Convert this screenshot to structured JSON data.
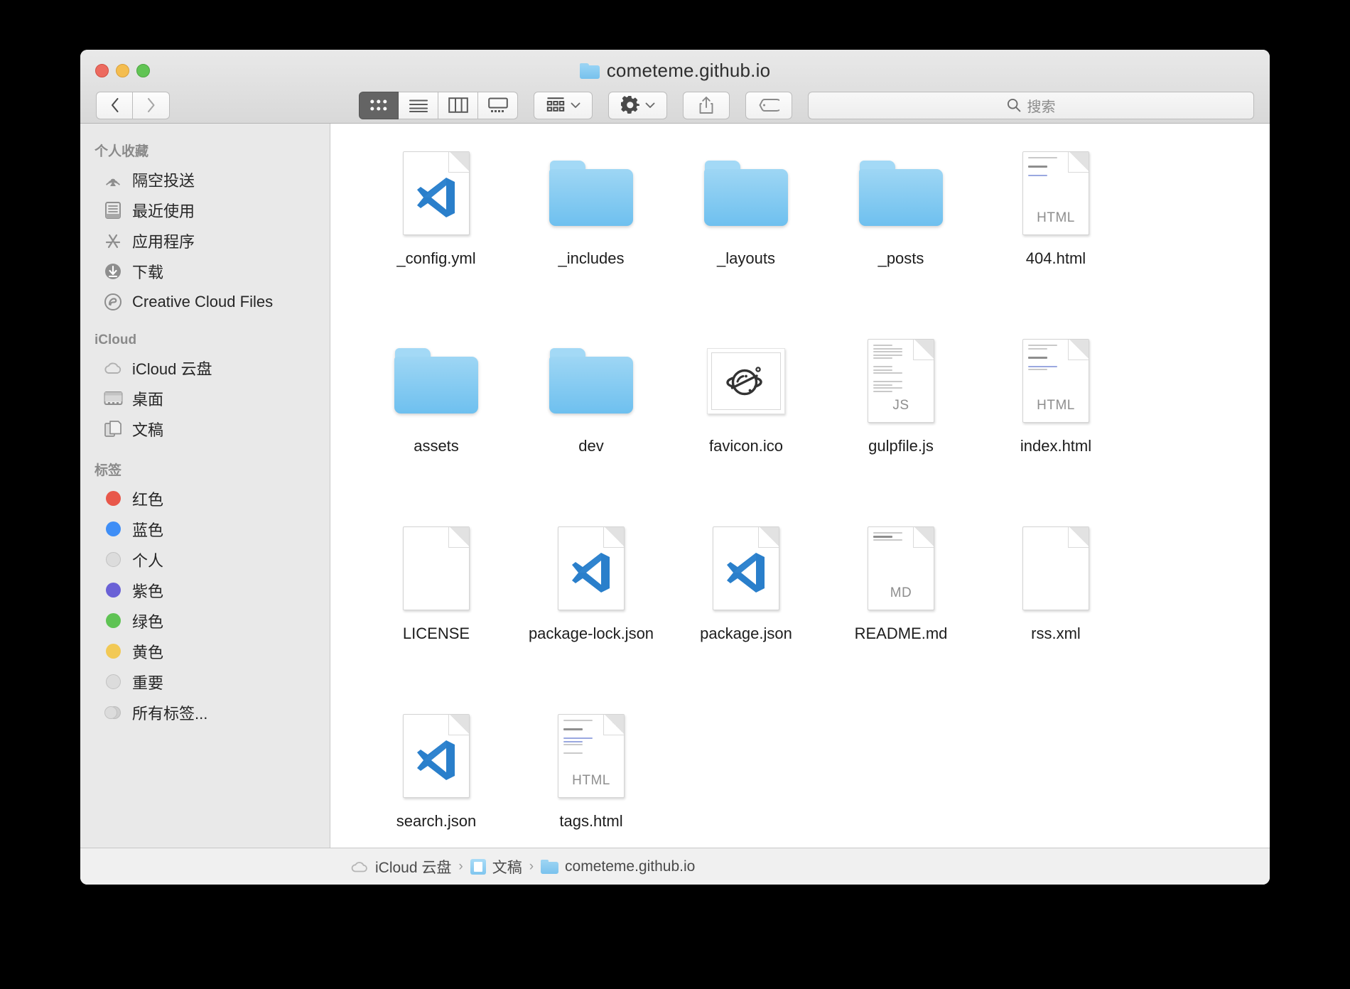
{
  "window": {
    "title": "cometeme.github.io",
    "traffic_lights": [
      "close",
      "minimize",
      "zoom"
    ]
  },
  "toolbar": {
    "back_label": "‹",
    "forward_label": "›",
    "views": [
      {
        "name": "icon-view",
        "label": "Icon view",
        "active": true
      },
      {
        "name": "list-view",
        "label": "List view",
        "active": false
      },
      {
        "name": "column-view",
        "label": "Column view",
        "active": false
      },
      {
        "name": "gallery-view",
        "label": "Gallery view",
        "active": false
      }
    ],
    "arrange_label": "Arrange",
    "action_label": "Action",
    "share_label": "Share",
    "tags_label": "Tags"
  },
  "search": {
    "placeholder": "搜索",
    "value": "",
    "icon": "search-icon"
  },
  "sidebar": {
    "sections": [
      {
        "heading": "个人收藏",
        "items": [
          {
            "label": "隔空投送",
            "icon": "airdrop-icon"
          },
          {
            "label": "最近使用",
            "icon": "recents-icon"
          },
          {
            "label": "应用程序",
            "icon": "applications-icon"
          },
          {
            "label": "下载",
            "icon": "downloads-icon"
          },
          {
            "label": "Creative Cloud Files",
            "icon": "creative-cloud-icon"
          }
        ]
      },
      {
        "heading": "iCloud",
        "items": [
          {
            "label": "iCloud 云盘",
            "icon": "cloud-icon"
          },
          {
            "label": "桌面",
            "icon": "desktop-icon"
          },
          {
            "label": "文稿",
            "icon": "documents-icon"
          }
        ]
      },
      {
        "heading": "标签",
        "items": [
          {
            "label": "红色",
            "icon": "tag-dot",
            "color": "#e8574a"
          },
          {
            "label": "蓝色",
            "icon": "tag-dot",
            "color": "#3f8ef6"
          },
          {
            "label": "个人",
            "icon": "tag-dot",
            "color": "#dcdcdc"
          },
          {
            "label": "紫色",
            "icon": "tag-dot",
            "color": "#6a61d6"
          },
          {
            "label": "绿色",
            "icon": "tag-dot",
            "color": "#5fc martingale"
          },
          {
            "label": "黄色",
            "icon": "tag-dot",
            "color": "#f2c council"
          },
          {
            "label": "重要",
            "icon": "tag-dot",
            "color": "#dcdcdc"
          },
          {
            "label": "所有标签...",
            "icon": "all-tags-icon",
            "color": "#dcdcdc"
          }
        ]
      }
    ]
  },
  "files": [
    {
      "name": "_config.yml",
      "kind": "vscode-file"
    },
    {
      "name": "_includes",
      "kind": "folder"
    },
    {
      "name": "_layouts",
      "kind": "folder"
    },
    {
      "name": "_posts",
      "kind": "folder"
    },
    {
      "name": "404.html",
      "kind": "html-file",
      "badge": "HTML"
    },
    {
      "name": "assets",
      "kind": "folder"
    },
    {
      "name": "dev",
      "kind": "folder"
    },
    {
      "name": "favicon.ico",
      "kind": "ico-file"
    },
    {
      "name": "gulpfile.js",
      "kind": "js-file",
      "badge": "JS"
    },
    {
      "name": "index.html",
      "kind": "html-file",
      "badge": "HTML"
    },
    {
      "name": "LICENSE",
      "kind": "blank-file"
    },
    {
      "name": "package-lock.json",
      "kind": "vscode-file"
    },
    {
      "name": "package.json",
      "kind": "vscode-file"
    },
    {
      "name": "README.md",
      "kind": "md-file",
      "badge": "MD"
    },
    {
      "name": "rss.xml",
      "kind": "blank-file"
    },
    {
      "name": "search.json",
      "kind": "vscode-file"
    },
    {
      "name": "tags.html",
      "kind": "html-file",
      "badge": "HTML"
    }
  ],
  "pathbar": {
    "crumbs": [
      {
        "label": "iCloud 云盘",
        "icon": "cloud-icon"
      },
      {
        "label": "文稿",
        "icon": "documents-folder-icon"
      },
      {
        "label": "cometeme.github.io",
        "icon": "folder-icon"
      }
    ],
    "separator": "›"
  },
  "colors": {
    "folder_blue": "#7fc6ef",
    "vscode_blue": "#2a7fcb",
    "window_chrome": "#e5e5e5",
    "sidebar_bg": "#e9e9e9"
  }
}
